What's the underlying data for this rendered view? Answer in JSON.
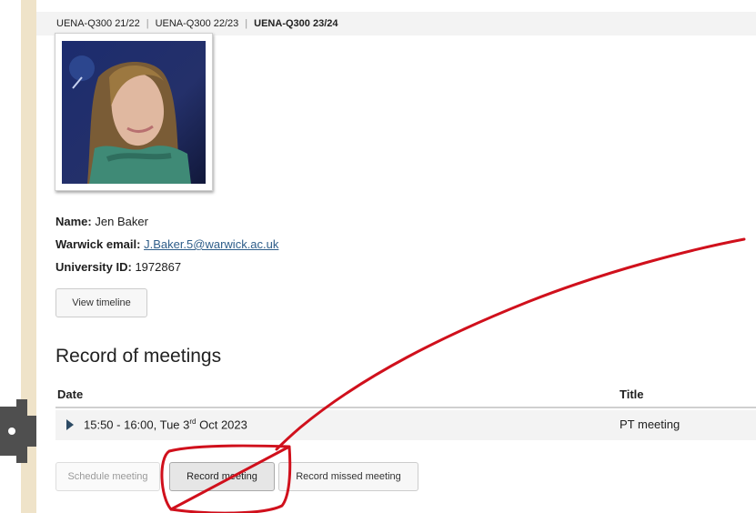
{
  "years": {
    "items": [
      {
        "label": "UENA-Q300 21/22",
        "active": false
      },
      {
        "label": "UENA-Q300 22/23",
        "active": false
      },
      {
        "label": "UENA-Q300 23/24",
        "active": true
      }
    ]
  },
  "student": {
    "name_label": "Name:",
    "name": "Jen Baker",
    "email_label": "Warwick email:",
    "email": "J.Baker.5@warwick.ac.uk",
    "id_label": "University ID:",
    "id": "1972867"
  },
  "buttons": {
    "view_timeline": "View timeline",
    "schedule_meeting": "Schedule meeting",
    "record_meeting": "Record meeting",
    "record_missed_meeting": "Record missed meeting"
  },
  "meetings": {
    "heading": "Record of meetings",
    "columns": {
      "date": "Date",
      "title": "Title"
    },
    "rows": [
      {
        "date_prefix": "15:50 - 16:00, Tue 3",
        "date_sup": "rd",
        "date_suffix": " Oct 2023",
        "title": "PT meeting"
      }
    ]
  },
  "colors": {
    "accent_strip": "#efe3c9",
    "link": "#2f5e8a",
    "annotation": "#d0101c"
  }
}
